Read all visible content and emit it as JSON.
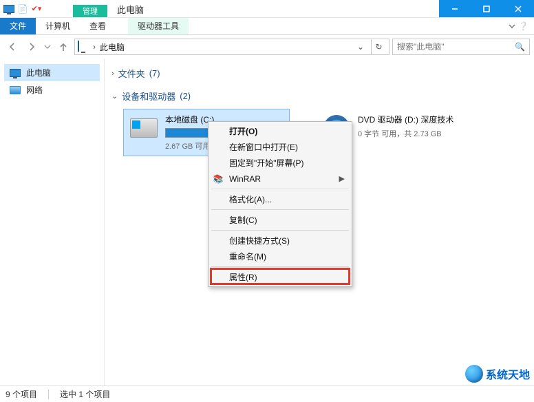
{
  "titlebar": {
    "contextual_tab_top": "管理",
    "contextual_tab_bottom": "驱动器工具",
    "title_tab": "此电脑"
  },
  "ribbon": {
    "file": "文件",
    "computer": "计算机",
    "view": "查看",
    "drive_tools": "驱动器工具"
  },
  "address": {
    "location": "此电脑",
    "separator": "›"
  },
  "search": {
    "placeholder": "搜索\"此电脑\""
  },
  "sidebar": {
    "items": [
      {
        "label": "此电脑",
        "icon": "monitor",
        "selected": true
      },
      {
        "label": "网络",
        "icon": "network",
        "selected": false
      }
    ]
  },
  "groups": {
    "folders": {
      "label": "文件夹",
      "count": "(7)"
    },
    "devices": {
      "label": "设备和驱动器",
      "count": "(2)"
    }
  },
  "drives": [
    {
      "name": "本地磁盘 (C:)",
      "free_text": "2.67 GB 可用",
      "fill_pct": 90,
      "selected": true,
      "icon": "hdd"
    },
    {
      "name": "DVD 驱动器 (D:) 深度技术",
      "free_text": "0 字节 可用，共 2.73 GB",
      "fill_pct": 0,
      "selected": false,
      "icon": "dvd"
    }
  ],
  "context_menu": {
    "items": [
      {
        "label": "打开(O)",
        "bold": true
      },
      {
        "label": "在新窗口中打开(E)"
      },
      {
        "label": "固定到\"开始\"屏幕(P)"
      },
      {
        "label": "WinRAR",
        "icon": "winrar",
        "submenu": true
      },
      {
        "sep": true
      },
      {
        "label": "格式化(A)..."
      },
      {
        "sep": true
      },
      {
        "label": "复制(C)"
      },
      {
        "sep": true
      },
      {
        "label": "创建快捷方式(S)"
      },
      {
        "label": "重命名(M)"
      },
      {
        "sep": true
      },
      {
        "label": "属性(R)",
        "highlight": true
      }
    ]
  },
  "statusbar": {
    "count": "9 个项目",
    "selected": "选中 1 个项目"
  },
  "watermark": "系统天地",
  "colors": {
    "accent": "#1979ca",
    "ctx_green": "#1abc9c"
  }
}
